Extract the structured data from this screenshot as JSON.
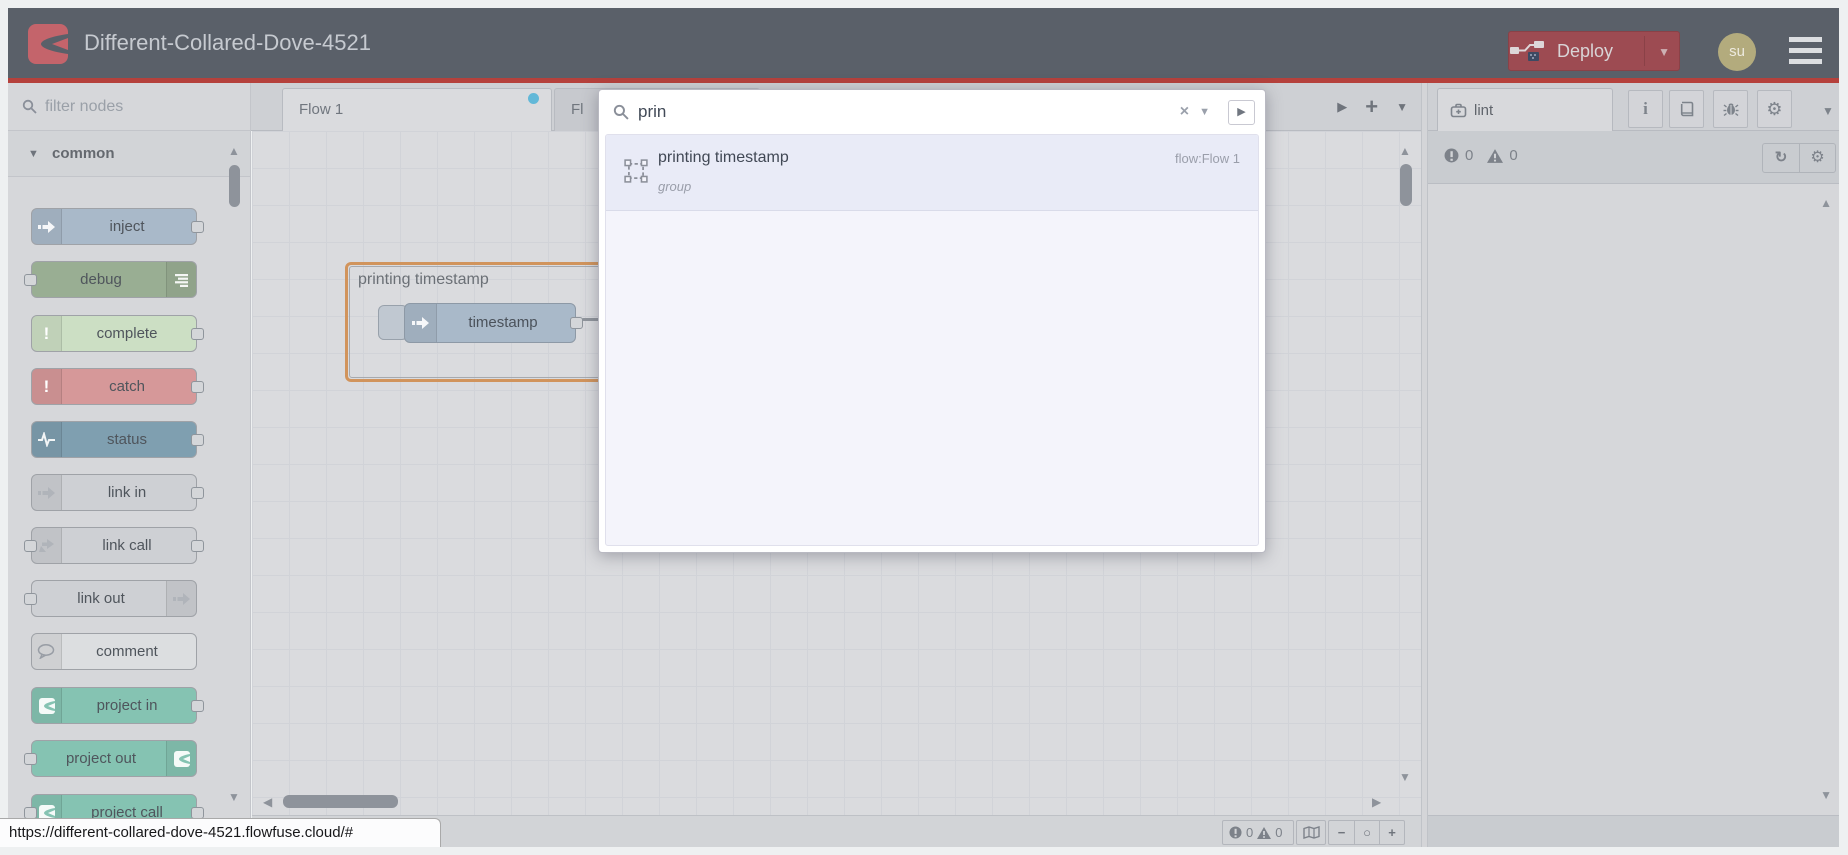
{
  "header": {
    "title": "Different-Collared-Dove-4521",
    "deploy_label": "Deploy",
    "avatar_initials": "su"
  },
  "palette": {
    "filter_placeholder": "filter nodes",
    "category": "common",
    "nodes": [
      {
        "label": "inject"
      },
      {
        "label": "debug"
      },
      {
        "label": "complete"
      },
      {
        "label": "catch"
      },
      {
        "label": "status"
      },
      {
        "label": "link in"
      },
      {
        "label": "link call"
      },
      {
        "label": "link out"
      },
      {
        "label": "comment"
      },
      {
        "label": "project in"
      },
      {
        "label": "project out"
      },
      {
        "label": "project call"
      }
    ]
  },
  "workspace": {
    "tabs": [
      {
        "label": "Flow 1",
        "unsaved": true
      },
      {
        "label": "Fl"
      }
    ],
    "group_label": "printing timestamp",
    "node_label": "timestamp"
  },
  "search": {
    "value": "prin",
    "results": [
      {
        "title": "printing timestamp",
        "type": "group",
        "flow": "flow:Flow 1"
      }
    ]
  },
  "sidebar": {
    "tab_label": "lint",
    "errors": "0",
    "warnings": "0"
  },
  "canvas_footer": {
    "errors": "0",
    "warnings": "0",
    "zoom_out": "−",
    "zoom_reset": "○",
    "zoom_in": "+"
  },
  "status_tooltip": {
    "url": "https://different-collared-dove-4521.flowfuse.cloud/#"
  },
  "colors": {
    "header_bg": "#5a6069",
    "deploy_red": "#9d4b52",
    "header_underline": "#b5413c",
    "logo_red": "#c4646b",
    "unsaved_dot": "#62b8d8",
    "group_border_selected": "#d1945c",
    "node_inject": "#a9b9c9",
    "node_debug": "#99ae93",
    "node_complete": "#ccdfc4",
    "node_catch": "#d69899",
    "node_status": "#7f9fb0",
    "node_link": "#ced0d4",
    "node_comment": "#dcdee0",
    "node_project": "#85c3b2"
  }
}
